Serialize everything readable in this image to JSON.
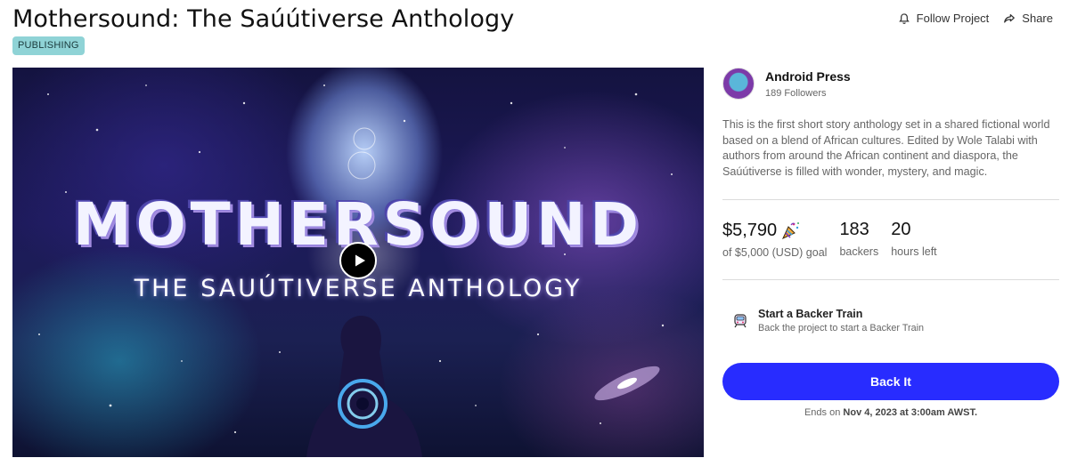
{
  "project": {
    "title": "Mothersound: The Saúútiverse Anthology",
    "category_tag": "PUBLISHING"
  },
  "actions": {
    "follow_label": "Follow Project",
    "share_label": "Share"
  },
  "hero": {
    "headline": "MOTHERSOUND",
    "subtitle": "THE SAUÚTIVERSE ANTHOLOGY",
    "play_icon": "play-icon"
  },
  "creator": {
    "name": "Android Press",
    "followers": "189 Followers"
  },
  "blurb": "This is the first short story anthology set in a shared fictional world based on a blend of African cultures. Edited by Wole Talabi with authors from around the African continent and diaspora, the Saúútiverse is filled with wonder, mystery, and magic.",
  "stats": {
    "pledged": "$5,790",
    "pledged_icon": "party-popper-icon",
    "goal_label": "of $5,000 (USD) goal",
    "backers_value": "183",
    "backers_label": "backers",
    "hours_value": "20",
    "hours_label": "hours left"
  },
  "backer_train": {
    "title": "Start a Backer Train",
    "subtitle": "Back the project to start a Backer Train",
    "icon": "train-icon"
  },
  "cta": {
    "back_label": "Back It",
    "accent": "#282cff"
  },
  "ends": {
    "prefix": "Ends on",
    "date": "Nov 4, 2023 at 3:00am AWST."
  }
}
